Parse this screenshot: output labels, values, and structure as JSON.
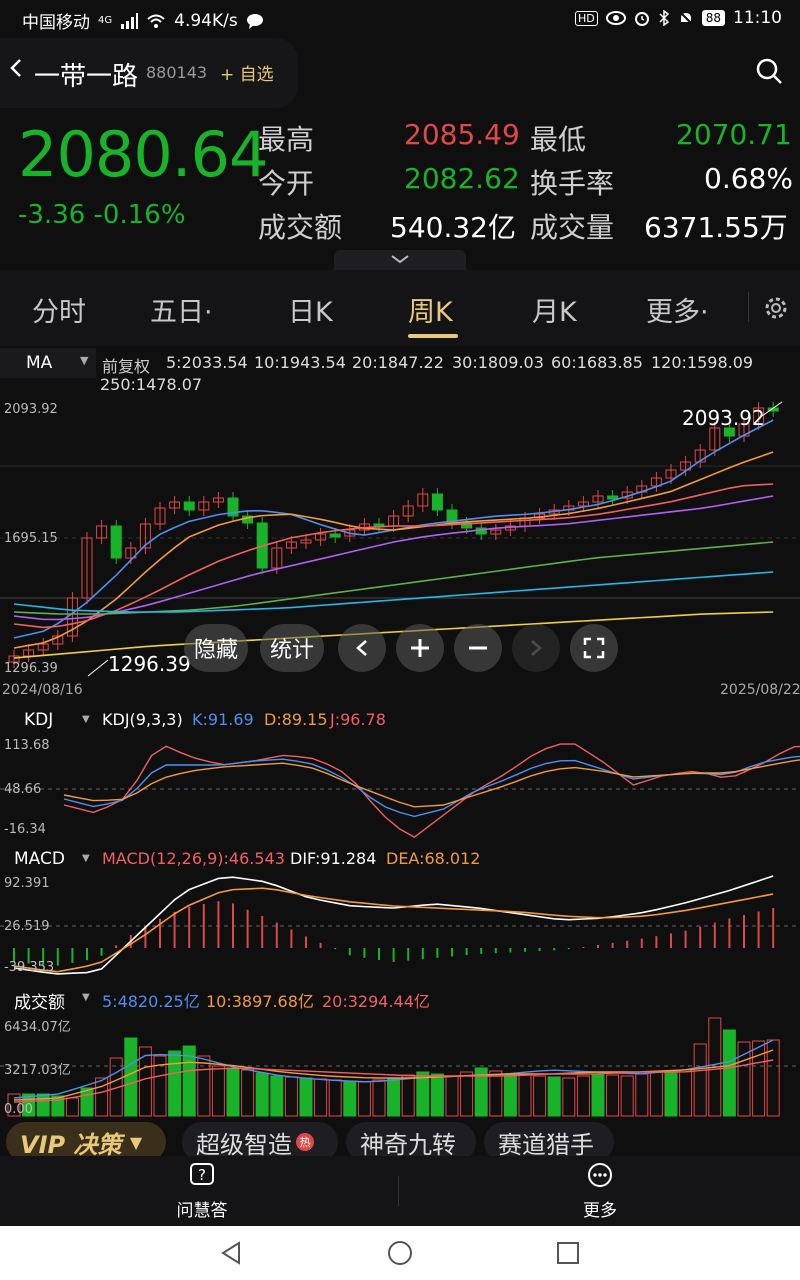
{
  "status": {
    "carrier": "中国移动",
    "net": "4G",
    "speed": "4.94K/s",
    "battery": "88",
    "time": "11:10"
  },
  "header": {
    "back_icon": "back-chevron-icon",
    "name": "一带一路",
    "code": "880143",
    "add_label": "+ 自选"
  },
  "quote": {
    "price": "2080.64",
    "change": "-3.36",
    "change_pct": "-0.16%",
    "high_label": "最高",
    "high": "2085.49",
    "low_label": "最低",
    "low": "2070.71",
    "open_label": "今开",
    "open": "2082.62",
    "turnover_label": "换手率",
    "turnover": "0.68%",
    "amount_label": "成交额",
    "amount": "540.32亿",
    "volume_label": "成交量",
    "volume": "6371.55万",
    "up_color": "#e04848",
    "down_color": "#19b32a"
  },
  "tabs": [
    {
      "label": "分时"
    },
    {
      "label": "五日·"
    },
    {
      "label": "日K"
    },
    {
      "label": "周K"
    },
    {
      "label": "月K"
    },
    {
      "label": "更多·"
    }
  ],
  "ma_panel": {
    "indicator": "MA",
    "adjust": "前复权",
    "items": [
      {
        "t": "5:2033.54",
        "c": "#4f8ff0"
      },
      {
        "t": "10:1943.54",
        "c": "#f39a3b"
      },
      {
        "t": "20:1847.22",
        "c": "#f06060"
      },
      {
        "t": "30:1809.03",
        "c": "#b060f0"
      },
      {
        "t": "60:1683.85",
        "c": "#5fb04a"
      },
      {
        "t": "120:1598.09",
        "c": "#23b8e8"
      },
      {
        "t": "250:1478.07",
        "c": "#f0d040"
      }
    ],
    "y_top": "2093.92",
    "y_mid": "1695.15",
    "y_low": "1296.39",
    "hi_mark": "2093.92",
    "lo_mark": "1296.39",
    "start_date": "2024/08/16",
    "end_date": "2025/08/22"
  },
  "chart_btns": {
    "hide": "隐藏",
    "stat": "统计"
  },
  "kdj": {
    "label": "KDJ",
    "params": "KDJ(9,3,3)",
    "k": "K:91.69",
    "d": "D:89.15",
    "j": "J:96.78",
    "y_top": "113.68",
    "y_mid": "48.66",
    "y_low": "-16.34"
  },
  "macd": {
    "label": "MACD",
    "params": "MACD(12,26,9):46.543",
    "dif": "DIF:91.284",
    "dea": "DEA:68.012",
    "y_top": "92.391",
    "y_mid": "26.519",
    "y_low": "-39.353"
  },
  "vol": {
    "label": "成交额",
    "ma5": "5:4820.25亿",
    "ma10": "10:3897.68亿",
    "ma20": "20:3294.44亿",
    "y_top": "6434.07亿",
    "y_mid": "3217.03亿",
    "y_low": "0.00"
  },
  "promo": {
    "vip": "VIP 决策",
    "p1": "超级智造",
    "hot": "热",
    "p2": "神奇九转",
    "p3": "赛道猎手"
  },
  "bottom": {
    "ask": "问慧答",
    "more": "更多"
  }
}
